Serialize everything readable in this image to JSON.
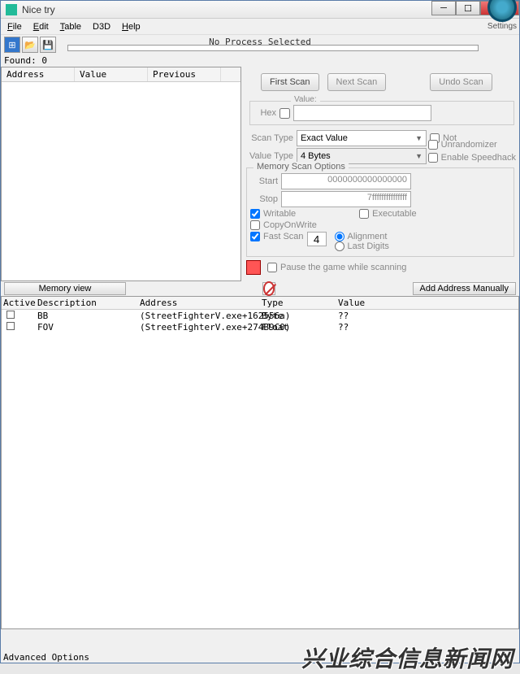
{
  "window": {
    "title": "Nice try"
  },
  "menu": {
    "file": "File",
    "file_ul": "F",
    "edit": "Edit",
    "edit_ul": "E",
    "table": "Table",
    "table_ul": "T",
    "d3d": "D3D",
    "help": "Help",
    "help_ul": "H"
  },
  "status": {
    "no_process": "No Process Selected",
    "found": "Found: 0"
  },
  "results": {
    "col_address": "Address",
    "col_value": "Value",
    "col_previous": "Previous"
  },
  "scan": {
    "first": "First Scan",
    "next": "Next Scan",
    "undo": "Undo Scan",
    "value_label": "Value:",
    "hex": "Hex",
    "scan_type_label": "Scan Type",
    "scan_type": "Exact Value",
    "not": "Not",
    "value_type_label": "Value Type",
    "value_type": "4 Bytes",
    "mem_title": "Memory Scan Options",
    "start_label": "Start",
    "start": "0000000000000000",
    "stop_label": "Stop",
    "stop": "7fffffffffffffff",
    "writable": "Writable",
    "executable": "Executable",
    "copyonwrite": "CopyOnWrite",
    "fast_scan": "Fast Scan",
    "fast_scan_val": "4",
    "alignment": "Alignment",
    "last_digits": "Last Digits",
    "pause": "Pause the game while scanning",
    "unrandomizer": "Unrandomizer",
    "speedhack": "Enable Speedhack",
    "settings": "Settings"
  },
  "buttons": {
    "memory_view": "Memory view",
    "add_manual": "Add Address Manually"
  },
  "cheat_table": {
    "col_active": "Active",
    "col_desc": "Description",
    "col_addr": "Address",
    "col_type": "Type",
    "col_value": "Value",
    "rows": [
      {
        "desc": "BB",
        "addr": "(StreetFighterV.exe+162556a)",
        "type": "Byte",
        "value": "??"
      },
      {
        "desc": "FOV",
        "addr": "(StreetFighterV.exe+274B9C0)",
        "type": "Float",
        "value": "??"
      }
    ]
  },
  "footer": {
    "advanced": "Advanced Options"
  },
  "watermark": "兴业综合信息新闻网"
}
